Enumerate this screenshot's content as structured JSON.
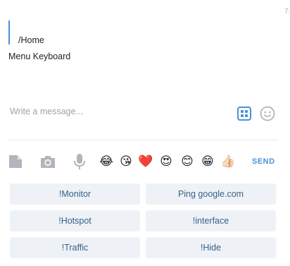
{
  "time_partial": "7:",
  "reply": {
    "text": "/Home"
  },
  "message": {
    "text": "Menu Keyboard"
  },
  "composer": {
    "placeholder": "Write a message..."
  },
  "toolbar": {
    "icons": [
      "file-icon",
      "camera-icon",
      "microphone-icon"
    ],
    "emojis": [
      "😂",
      "😘",
      "❤️",
      "😍",
      "😊",
      "😁",
      "👍🏻"
    ],
    "send_label": "SEND"
  },
  "keyboard": {
    "rows": [
      [
        "!Monitor",
        "Ping google.com"
      ],
      [
        "!Hotspot",
        "!interface"
      ],
      [
        "!Traffic",
        "!Hide"
      ]
    ]
  },
  "colors": {
    "accent": "#4a90d6",
    "key_bg": "#eef2f6",
    "key_text": "#37618a",
    "icon_gray": "#b0b6bc"
  }
}
